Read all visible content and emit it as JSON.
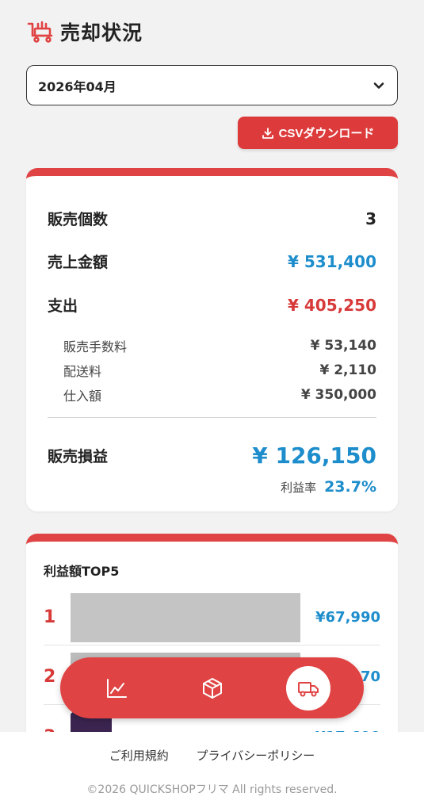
{
  "header": {
    "title": "売却状況",
    "icon": "cart-icon"
  },
  "month_select": {
    "value": "2026年04月"
  },
  "csv_button": {
    "label": "CSVダウンロード"
  },
  "summary": {
    "count_label": "販売個数",
    "count_value": "3",
    "sales_label": "売上金額",
    "sales_value": "¥ 531,400",
    "expense_label": "支出",
    "expense_value": "¥ 405,250",
    "fee_label": "販売手数料",
    "fee_value": "¥ 53,140",
    "shipping_label": "配送料",
    "shipping_value": "¥ 2,110",
    "purchase_label": "仕入額",
    "purchase_value": "¥ 350,000",
    "profit_label": "販売損益",
    "profit_value": "¥ 126,150",
    "rate_label": "利益率",
    "rate_value": "23.7%"
  },
  "top5": {
    "title": "利益額TOP5",
    "items": [
      {
        "rank": "1",
        "amount": "¥67,990"
      },
      {
        "rank": "2",
        "amount": "¥40,470"
      },
      {
        "rank": "3",
        "amount": "¥17,690"
      }
    ]
  },
  "nav": {
    "items": [
      "chart-icon",
      "box-icon",
      "truck-icon"
    ],
    "active": "truck-icon"
  },
  "footer": {
    "terms": "ご利用規約",
    "privacy": "プライバシーポリシー",
    "copyright": "©2026 QUICKSHOPフリマ All rights reserved."
  },
  "colors": {
    "accent": "#e04343",
    "blue": "#1e8dcc"
  }
}
